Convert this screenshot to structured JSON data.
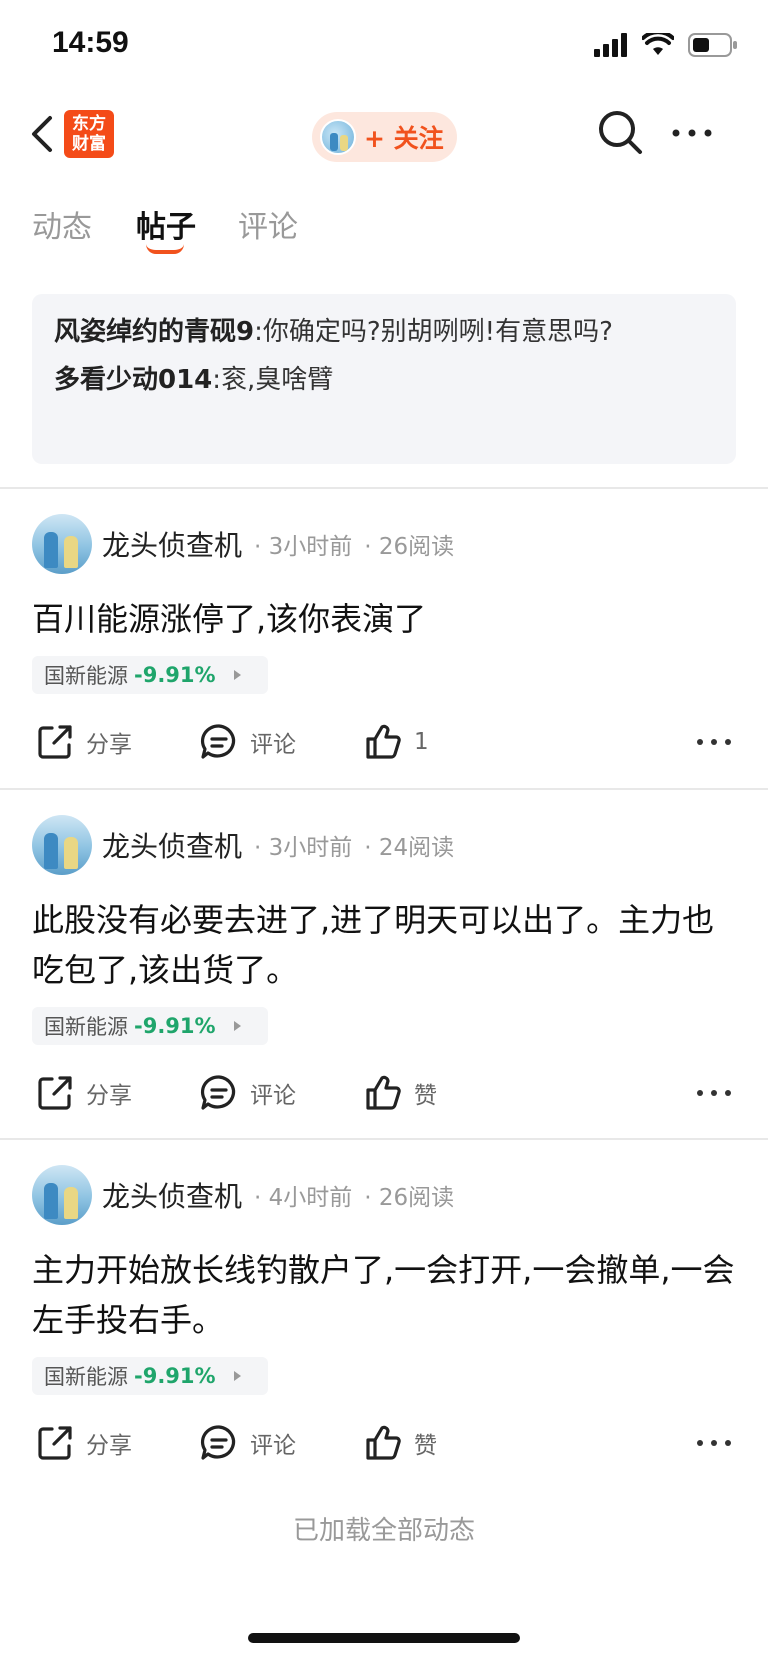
{
  "status": {
    "time": "14:59"
  },
  "nav": {
    "logo_text_line1": "东方",
    "logo_text_line2": "财富",
    "follow_label": "+ 关注"
  },
  "tabs": [
    {
      "label": "动态"
    },
    {
      "label": "帖子"
    },
    {
      "label": "评论"
    }
  ],
  "quotes": [
    {
      "name": "风姿绰约的青砚9",
      "text": "你确定吗?别胡咧咧!有意思吗?"
    },
    {
      "name": "多看少动014",
      "text": "衮,臭啥臂"
    }
  ],
  "posts": [
    {
      "author": "龙头侦查机",
      "time": "3小时前",
      "reads": "26阅读",
      "text": "百川能源涨停了,该你表演了",
      "stock_name": "国新能源",
      "stock_change": "-9.91%",
      "share_label": "分享",
      "comment_label": "评论",
      "like_label": "1"
    },
    {
      "author": "龙头侦查机",
      "time": "3小时前",
      "reads": "24阅读",
      "text": "此股没有必要去进了,进了明天可以出了。主力也吃包了,该出货了。",
      "stock_name": "国新能源",
      "stock_change": "-9.91%",
      "share_label": "分享",
      "comment_label": "评论",
      "like_label": "赞"
    },
    {
      "author": "龙头侦查机",
      "time": "4小时前",
      "reads": "26阅读",
      "text": "主力开始放长线钓散户了,一会打开,一会撤单,一会左手投右手。",
      "stock_name": "国新能源",
      "stock_change": "-9.91%",
      "share_label": "分享",
      "comment_label": "评论",
      "like_label": "赞"
    }
  ],
  "footer": {
    "text": "已加载全部动态"
  },
  "colors": {
    "accent": "#f1521d",
    "down_green": "#1fa56b",
    "logo_bg": "#f44b18"
  }
}
